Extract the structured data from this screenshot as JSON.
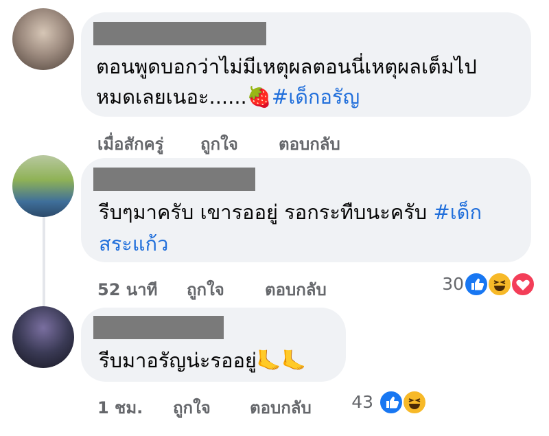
{
  "comments": [
    {
      "text_lines": [
        "ตอนพูดบอกว่าไม่มีเหตุผลตอนนี่เหตุผลเต็มไป",
        "หมดเลยเนอะ......"
      ],
      "emoji": "🍓",
      "hashtag": "#เด็กอรัญ",
      "time": "เมื่อสักครู่",
      "like_label": "ถูกใจ",
      "reply_label": "ตอบกลับ",
      "reaction_count": "",
      "avatar_colors": [
        "#c9b8a8",
        "#6b5a50"
      ]
    },
    {
      "text_line1": "รีบๆมาครับ เขารออยู่  รอกระทืบนะครับ ",
      "hashtag_part1": "#เด็ก",
      "hashtag_part2": "สระแก้ว",
      "time": "52 นาที",
      "like_label": "ถูกใจ",
      "reply_label": "ตอบกลับ",
      "reaction_count": "30",
      "reactions": [
        "like-icon",
        "haha-icon",
        "love-icon"
      ],
      "avatar_colors": [
        "#9fb86a",
        "#2f5a8a"
      ]
    },
    {
      "text_line1": "รีบมาอรัญน่ะรออยู่",
      "emoji": "🦶🦶",
      "time": "1 ชม.",
      "like_label": "ถูกใจ",
      "reply_label": "ตอบกลับ",
      "reaction_count": "43",
      "reactions": [
        "like-icon",
        "haha-icon"
      ],
      "avatar_colors": [
        "#5a5a72",
        "#1e1e2a"
      ]
    }
  ],
  "colors": {
    "bubble": "#f0f2f5",
    "hashtag": "#216fdb",
    "meta": "#65676b",
    "like": "#1877f2",
    "haha": "#f7b928",
    "love": "#f33e58"
  }
}
